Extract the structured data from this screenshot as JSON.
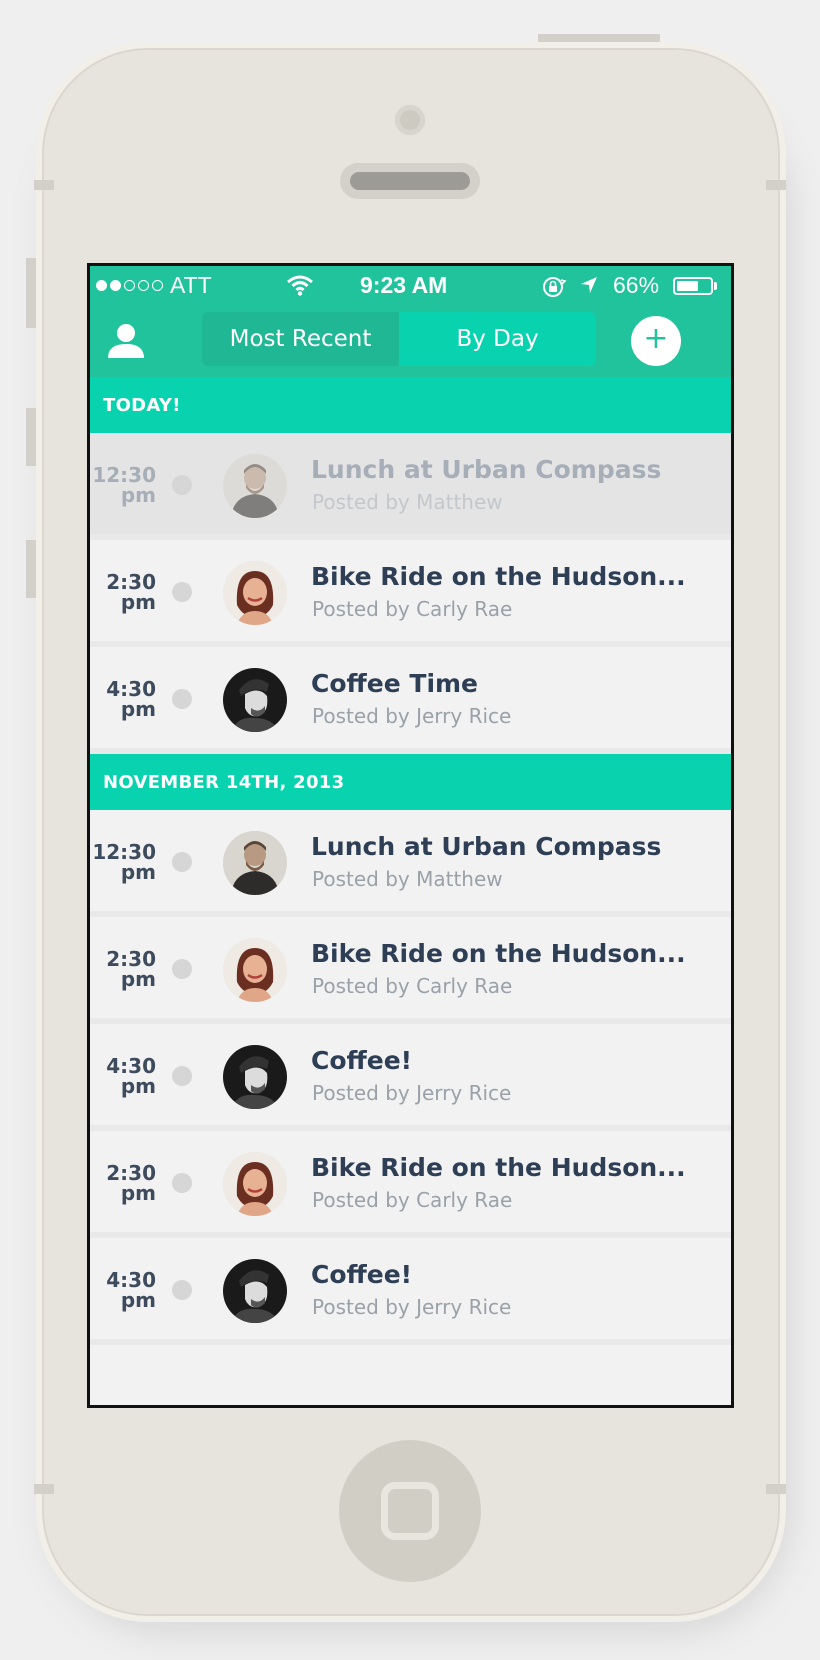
{
  "status_bar": {
    "carrier": "ATT",
    "time": "9:23 AM",
    "battery": "66%",
    "battery_level": 0.66,
    "signal_bars": 2,
    "signal_total": 5
  },
  "nav": {
    "segments": [
      {
        "label": "Most Recent",
        "active": false
      },
      {
        "label": "By Day",
        "active": true
      }
    ],
    "add_label": "+"
  },
  "sections": [
    {
      "header": "TODAY!",
      "items": [
        {
          "time": "12:30",
          "ampm": "pm",
          "title": "Lunch at Urban Compass",
          "byline": "Posted by Matthew",
          "avatar": "person-matthew",
          "highlighted": true
        },
        {
          "time": "2:30",
          "ampm": "pm",
          "title": "Bike Ride on the Hudson...",
          "byline": "Posted by Carly Rae",
          "avatar": "person-carly"
        },
        {
          "time": "4:30",
          "ampm": "pm",
          "title": "Coffee Time",
          "byline": "Posted by Jerry Rice",
          "avatar": "person-jerry"
        }
      ]
    },
    {
      "header": "NOVEMBER 14TH, 2013",
      "items": [
        {
          "time": "12:30",
          "ampm": "pm",
          "title": "Lunch at Urban Compass",
          "byline": "Posted by Matthew",
          "avatar": "person-matthew"
        },
        {
          "time": "2:30",
          "ampm": "pm",
          "title": "Bike Ride on the Hudson...",
          "byline": "Posted by Carly Rae",
          "avatar": "person-carly"
        },
        {
          "time": "4:30",
          "ampm": "pm",
          "title": "Coffee!",
          "byline": "Posted by Jerry Rice",
          "avatar": "person-jerry"
        },
        {
          "time": "2:30",
          "ampm": "pm",
          "title": "Bike Ride on the Hudson...",
          "byline": "Posted by Carly Rae",
          "avatar": "person-carly"
        },
        {
          "time": "4:30",
          "ampm": "pm",
          "title": "Coffee!",
          "byline": "Posted by Jerry Rice",
          "avatar": "person-jerry"
        }
      ]
    }
  ],
  "colors": {
    "accent": "#21c39d",
    "header": "#08d3ae",
    "title_text": "#2e3f55",
    "muted_text": "#9aa1a9"
  }
}
